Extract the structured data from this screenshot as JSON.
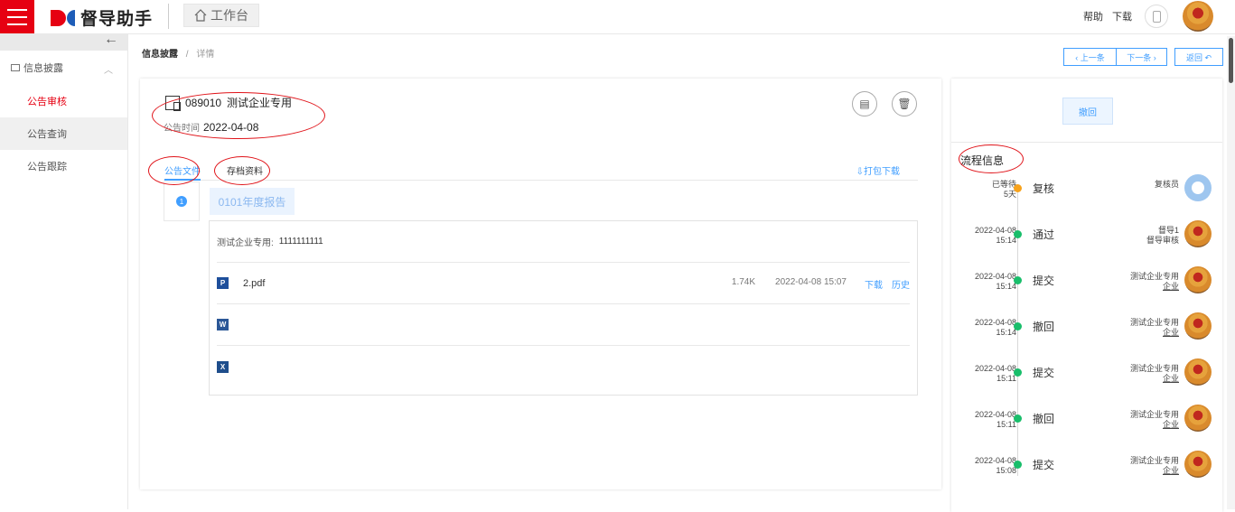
{
  "header": {
    "app_name": "督导助手",
    "workbench_label": "工作台",
    "help_label": "帮助",
    "download_label": "下载"
  },
  "sidebar": {
    "group_label": "信息披露",
    "items": [
      {
        "label": "公告审核",
        "active": true
      },
      {
        "label": "公告查询",
        "active": false
      },
      {
        "label": "公告跟踪",
        "active": false
      }
    ]
  },
  "breadcrumb": {
    "parent": "信息披露",
    "separator": "/",
    "current": "详情"
  },
  "nav_buttons": {
    "prev": "‹ 上一条",
    "next": "下一条 ›",
    "back": "返回 ↶"
  },
  "announcement": {
    "code": "089010",
    "company": "测试企业专用",
    "time_label": "公告时间",
    "date": "2022-04-08"
  },
  "tabs": [
    {
      "label": "公告文件",
      "active": true
    },
    {
      "label": "存档资料",
      "active": false
    }
  ],
  "package_download": "⇩打包下载",
  "doc": {
    "index": "1",
    "report_name": "0101年度报告",
    "company_line_label": "测试企业专用:",
    "company_line_value": "1111111111",
    "files": [
      {
        "icon": "pdf-file-icon",
        "name": "2.pdf",
        "size": "1.74K",
        "time": "2022-04-08 15:07",
        "download": "下载",
        "history": "历史"
      },
      {
        "icon": "word-file-icon",
        "name": "",
        "size": "",
        "time": "",
        "download": "",
        "history": ""
      },
      {
        "icon": "excel-file-icon",
        "name": "",
        "size": "",
        "time": "",
        "download": "",
        "history": ""
      }
    ]
  },
  "side": {
    "withdraw_label": "撤回",
    "flow_title": "流程信息",
    "flow": [
      {
        "t1": "已等待",
        "t2": "5天",
        "action": "复核",
        "user": "复核员",
        "role": "",
        "status": "waiting"
      },
      {
        "t1": "2022-04-08",
        "t2": "15:14",
        "action": "通过",
        "user": "督导1",
        "role": "督导审核",
        "status": "done"
      },
      {
        "t1": "2022-04-08",
        "t2": "15:14",
        "action": "提交",
        "user": "测试企业专用",
        "role": "企业",
        "status": "done"
      },
      {
        "t1": "2022-04-08",
        "t2": "15:14",
        "action": "撤回",
        "user": "测试企业专用",
        "role": "企业",
        "status": "done"
      },
      {
        "t1": "2022-04-08",
        "t2": "15:11",
        "action": "提交",
        "user": "测试企业专用",
        "role": "企业",
        "status": "done"
      },
      {
        "t1": "2022-04-08",
        "t2": "15:11",
        "action": "撤回",
        "user": "测试企业专用",
        "role": "企业",
        "status": "done"
      },
      {
        "t1": "2022-04-08",
        "t2": "15:08",
        "action": "提交",
        "user": "测试企业专用",
        "role": "企业",
        "status": "done"
      }
    ]
  },
  "colors": {
    "brand_red": "#e60012",
    "primary_blue": "#409eff",
    "success_green": "#19be6b",
    "warning_orange": "#f7a21b"
  }
}
